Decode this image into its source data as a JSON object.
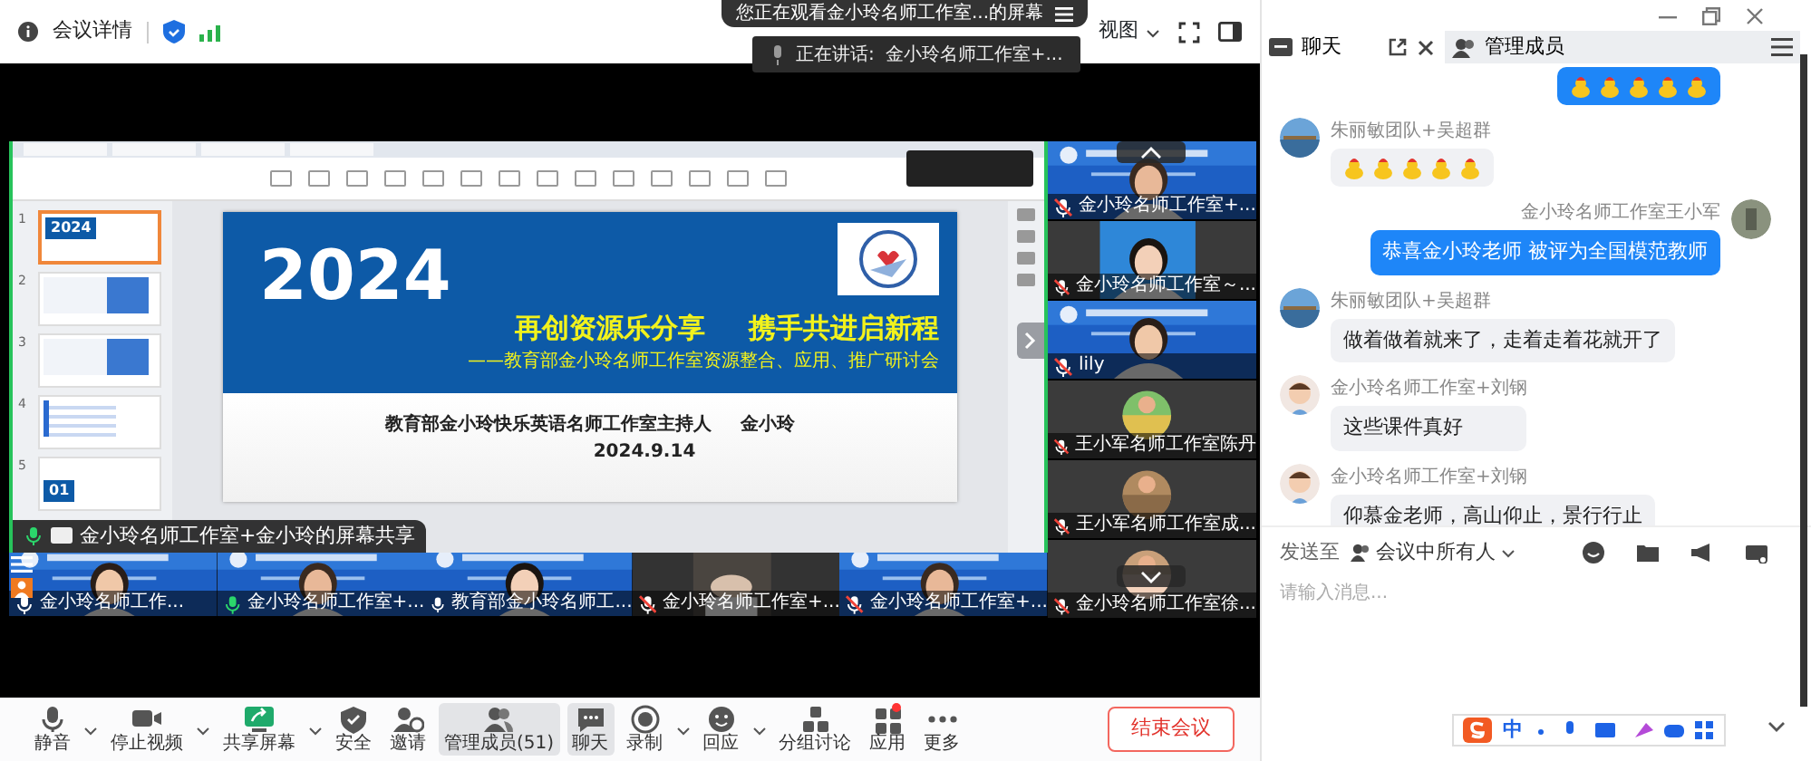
{
  "top_bar": {
    "meeting_details": "会议详情",
    "view": "视图"
  },
  "viewing_banner": "您正在观看金小玲名师工作室...的屏幕",
  "speaking_toast": {
    "label": "正在讲话:",
    "name": "金小玲名师工作室+..."
  },
  "shared_screen": {
    "share_label": "金小玲名师工作室+金小玲的屏幕共享",
    "thumbnails": [
      {
        "number": "1",
        "kind": "title",
        "text": "2024",
        "selected": true
      },
      {
        "number": "2",
        "kind": "content",
        "selected": false
      },
      {
        "number": "3",
        "kind": "content",
        "selected": false
      },
      {
        "number": "4",
        "kind": "list",
        "selected": false
      },
      {
        "number": "5",
        "kind": "section",
        "text": "01",
        "selected": false
      }
    ],
    "slide": {
      "year": "2024",
      "headline_1": "再创资源乐分享",
      "headline_2": "携手共进启新程",
      "subtitle": "——教育部金小玲名师工作室资源整合、应用、推广研讨会",
      "presenter": "教育部金小玲快乐英语名师工作室主持人",
      "presenter_name": "金小玲",
      "date": "2024.9.14"
    }
  },
  "side_videos": [
    {
      "name": "金小玲名师工作室+...",
      "kind": "video",
      "muted": true,
      "speaking": false
    },
    {
      "name": "金小玲名师工作室～...",
      "kind": "portrait",
      "muted": true,
      "speaking": false
    },
    {
      "name": "lily",
      "kind": "video",
      "muted": true,
      "speaking": false
    },
    {
      "name": "王小军名师工作室陈丹",
      "kind": "avatar",
      "muted": true,
      "speaking": false
    },
    {
      "name": "王小军名师工作室成...",
      "kind": "avatar",
      "muted": true,
      "speaking": false
    },
    {
      "name": "金小玲名师工作室徐...",
      "kind": "avatar",
      "muted": true,
      "speaking": false
    }
  ],
  "bottom_videos": [
    {
      "name": "金小玲名师工作...",
      "kind": "video",
      "muted": false,
      "speaking": false
    },
    {
      "name": "金小玲名师工作室+...",
      "kind": "video",
      "muted": false,
      "speaking": true
    },
    {
      "name": "教育部金小玲名师工...",
      "kind": "video",
      "muted": false,
      "speaking": false
    },
    {
      "name": "金小玲名师工作室+...",
      "kind": "dark",
      "muted": true,
      "speaking": false
    },
    {
      "name": "金小玲名师工作室+...",
      "kind": "video",
      "muted": true,
      "speaking": false
    }
  ],
  "toolbar": [
    {
      "label": "静音",
      "kind": "mic",
      "has_menu": true,
      "selected": false,
      "badge": false
    },
    {
      "label": "停止视频",
      "kind": "camera",
      "has_menu": true,
      "selected": false,
      "badge": false
    },
    {
      "label": "共享屏幕",
      "kind": "share",
      "has_menu": true,
      "selected": false,
      "badge": false
    },
    {
      "label": "安全",
      "kind": "shield",
      "has_menu": false,
      "selected": false,
      "badge": false
    },
    {
      "label": "邀请",
      "kind": "invite",
      "has_menu": false,
      "selected": false,
      "badge": false
    },
    {
      "label": "管理成员(51)",
      "kind": "members",
      "has_menu": false,
      "selected": true,
      "badge": false
    },
    {
      "label": "聊天",
      "kind": "chat",
      "has_menu": false,
      "selected": true,
      "badge": false
    },
    {
      "label": "录制",
      "kind": "record",
      "has_menu": true,
      "selected": false,
      "badge": false
    },
    {
      "label": "回应",
      "kind": "reaction",
      "has_menu": true,
      "selected": false,
      "badge": false
    },
    {
      "label": "分组讨论",
      "kind": "breakout",
      "has_menu": false,
      "selected": false,
      "badge": false
    },
    {
      "label": "应用",
      "kind": "apps",
      "has_menu": false,
      "selected": false,
      "badge": true
    },
    {
      "label": "更多",
      "kind": "more",
      "has_menu": false,
      "selected": false,
      "badge": false
    }
  ],
  "end_button": "结束会议",
  "chat": {
    "tabs": [
      {
        "label": "聊天",
        "kind": "chat",
        "selected": true
      },
      {
        "label": "管理成员",
        "kind": "members",
        "selected": false
      }
    ],
    "messages": [
      {
        "kind": "stickers",
        "mine": true,
        "stickers": [
          {
            "kind": "duck"
          },
          {
            "kind": "duck"
          },
          {
            "kind": "duck"
          },
          {
            "kind": "duck"
          },
          {
            "kind": "duck"
          }
        ]
      },
      {
        "kind": "stickers",
        "mine": false,
        "sender": "朱丽敏团队+吴超群",
        "avatar": {
          "kind": "landscape"
        },
        "stickers": [
          {
            "kind": "duck"
          },
          {
            "kind": "duck"
          },
          {
            "kind": "duck"
          },
          {
            "kind": "duck"
          },
          {
            "kind": "duck"
          }
        ]
      },
      {
        "kind": "text",
        "mine": true,
        "sender": "金小玲名师工作室王小军",
        "text": "恭喜金小玲老师  被评为全国模范教师"
      },
      {
        "kind": "text",
        "mine": false,
        "sender": "朱丽敏团队+吴超群",
        "avatar": {
          "kind": "landscape"
        },
        "text": "做着做着就来了，走着走着花就开了"
      },
      {
        "kind": "text",
        "mine": false,
        "sender": "金小玲名师工作室+刘钢",
        "avatar": {
          "kind": "cartoon"
        },
        "text": "这些课件真好"
      },
      {
        "kind": "text",
        "mine": false,
        "sender": "金小玲名师工作室+刘钢",
        "avatar": {
          "kind": "cartoon"
        },
        "text": "仰慕金老师，高山仰止，景行行止"
      }
    ],
    "send_to": "发送至",
    "recipient": "会议中所有人",
    "placeholder": "请输入消息...",
    "ime_mode": "中"
  }
}
